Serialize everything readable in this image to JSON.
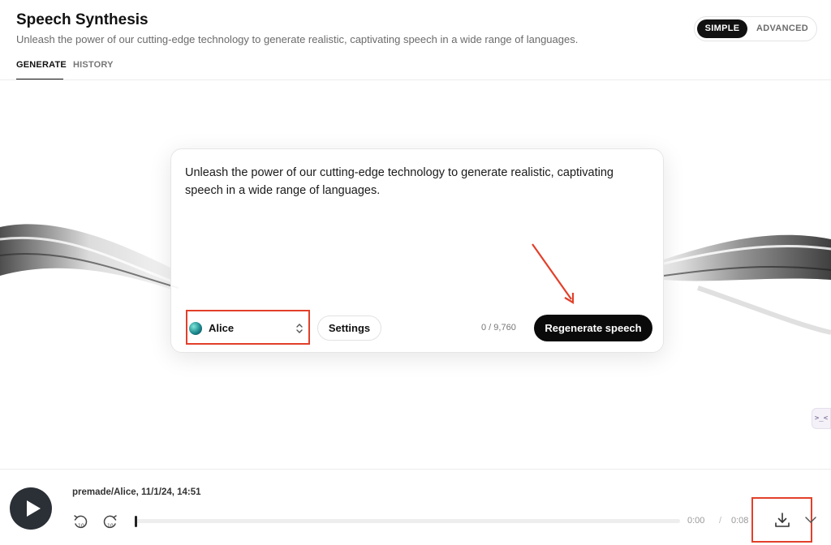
{
  "header": {
    "title": "Speech Synthesis",
    "subtitle": "Unleash the power of our cutting-edge technology to generate realistic, captivating speech in a wide range of languages.",
    "mode": {
      "options": [
        "SIMPLE",
        "ADVANCED"
      ],
      "selected": "SIMPLE"
    },
    "tabs": [
      {
        "label": "GENERATE",
        "active": true
      },
      {
        "label": "HISTORY",
        "active": false
      }
    ]
  },
  "editor": {
    "text": "Unleash the power of our cutting-edge technology to generate realistic, captivating speech in a wide range of languages.",
    "voice": {
      "name": "Alice",
      "icon": "voice-avatar"
    },
    "settings_label": "Settings",
    "char_count": "0 / 9,760",
    "regenerate_label": "Regenerate speech"
  },
  "side_widget": {
    "label": ">_<"
  },
  "player": {
    "track_title": "premade/Alice, 11/1/24, 14:51",
    "time_current": "0:00",
    "time_separator": "/",
    "time_total": "0:08",
    "progress": 0,
    "icons": [
      "play-icon",
      "rewind-10-icon",
      "forward-10-icon",
      "download-icon",
      "chevron-down-icon"
    ]
  },
  "colors": {
    "accent": "#0a0a0a",
    "annotation": "#e2402a",
    "play_button": "#2b2f36"
  }
}
